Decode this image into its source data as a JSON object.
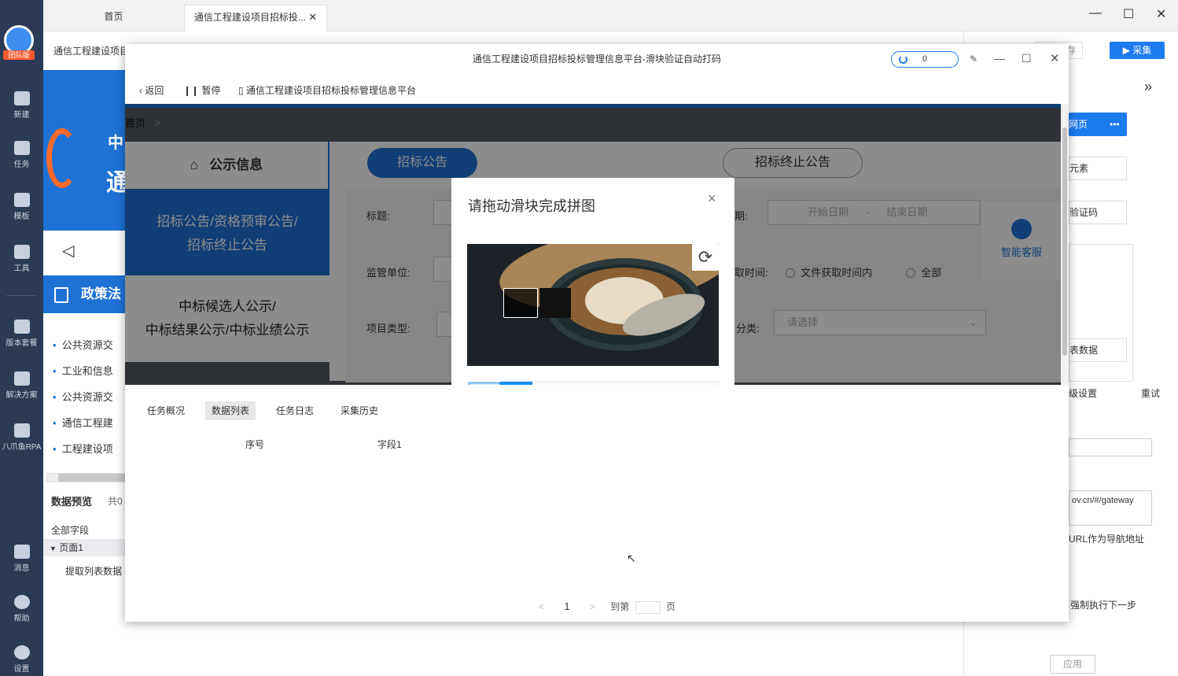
{
  "sidebar": {
    "logo_label": "团队版",
    "items": [
      {
        "label": "新建",
        "icon": "plus-icon"
      },
      {
        "label": "任务",
        "icon": "task-icon"
      },
      {
        "label": "模板",
        "icon": "template-icon"
      },
      {
        "label": "工具",
        "icon": "toolbox-icon"
      },
      {
        "label": "版本套餐",
        "icon": "crown-icon"
      },
      {
        "label": "解决方案",
        "icon": "solution-icon"
      },
      {
        "label": "八爪鱼RPA",
        "icon": "octopus-icon"
      },
      {
        "label": "消息",
        "icon": "bell-icon"
      },
      {
        "label": "帮助",
        "icon": "help-icon"
      },
      {
        "label": "设置",
        "icon": "gear-icon"
      }
    ]
  },
  "tabs": [
    {
      "label": "首页"
    },
    {
      "label": "通信工程建设项目招标投..."
    }
  ],
  "window": {
    "minimize": "—",
    "maximize": "☐",
    "close": "✕"
  },
  "bg": {
    "address_title": "通信工程建设项目",
    "save_btn": "存",
    "collect_btn": "▶ 采集",
    "banner_text_1": "中",
    "banner_text_2": "通",
    "policy_title": "政策法",
    "news": [
      "公共资源交",
      "工业和信息",
      "公共资源交",
      "通信工程建",
      "工程建设项"
    ],
    "data_preview": "数据预览",
    "total": "共0",
    "all_fields": "全部字段",
    "page1": "页面1",
    "extract": "提取列表数据",
    "right": {
      "webpage": "网页",
      "element": "元素",
      "captcha": "验证码",
      "table_data": "表数据",
      "advanced": "级设置",
      "retry": "重试",
      "url": "ov.cn/#/gateway",
      "url_nav": "URL作为导航地址",
      "force": "强制执行下一步",
      "apply": "应用"
    }
  },
  "dialog": {
    "title": "通信工程建设项目招标投标管理信息平台-滑块验证自动打码",
    "counter": "0",
    "back": "返回",
    "pause": "暂停",
    "page_title": "通信工程建设项目招标投标管理信息平台",
    "site": {
      "breadcrumb_home": "首页",
      "breadcrumb_sep": ">",
      "breadcrumb_cur": "招标公告",
      "menu_title": "公示信息",
      "menu_active": "招标公告/资格预审公告/\n招标终止公告",
      "menu_2": "中标候选人公示/\n中标结果公示/中标业绩公示",
      "tab_1": "招标公告",
      "tab_2": "招标终止公告",
      "f_title": "标题:",
      "f_date": "期:",
      "date_start": "开始日期",
      "date_sep": "-",
      "date_end": "结束日期",
      "f_regulator": "监管单位:",
      "f_time": "取时间:",
      "radio_1": "文件获取时间内",
      "radio_2": "全部",
      "f_type": "项目类型:",
      "f_cat": "分类:",
      "select_ph": "请选择",
      "service": "智能客服"
    },
    "captcha": {
      "title": "请拖动滑块完成拼图",
      "close": "×"
    },
    "bottom_tabs": [
      "任务概况",
      "数据列表",
      "任务日志",
      "采集历史"
    ],
    "columns": [
      "序号",
      "字段1"
    ],
    "pager": {
      "prev": "<",
      "page": "1",
      "next": ">",
      "goto": "到第",
      "suffix": "页"
    }
  }
}
